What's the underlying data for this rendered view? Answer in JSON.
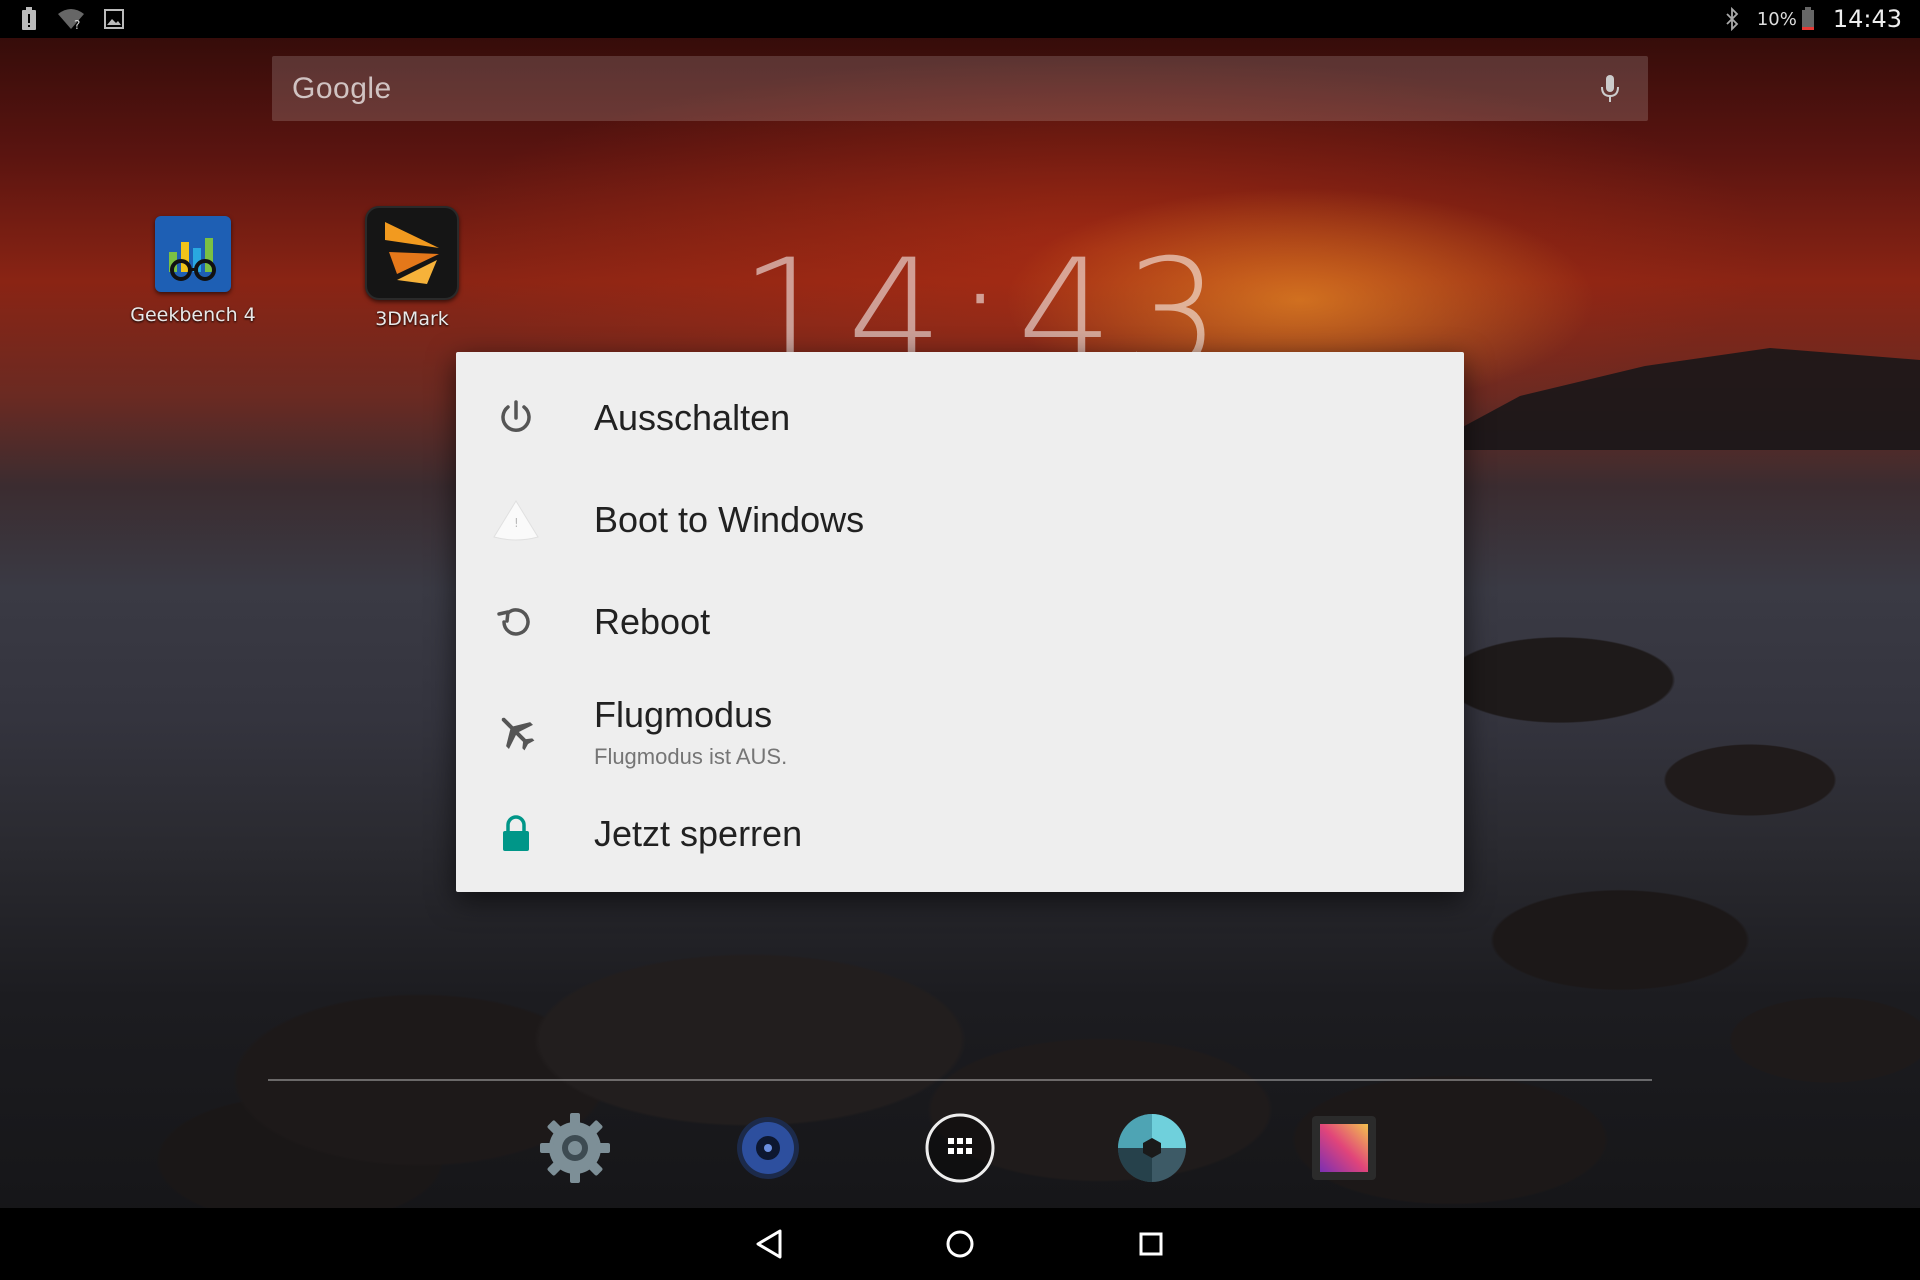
{
  "status_bar": {
    "battery_percent": "10%",
    "time": "14:43"
  },
  "search_bar": {
    "logo_text": "Google"
  },
  "desktop_apps": [
    {
      "label": "Geekbench 4",
      "icon": "geekbench-icon"
    },
    {
      "label": "3DMark",
      "icon": "3dmark-icon"
    }
  ],
  "clock_widget": {
    "time": "14:43"
  },
  "power_dialog": {
    "items": [
      {
        "label": "Ausschalten",
        "icon": "power-icon"
      },
      {
        "label": "Boot to Windows",
        "icon": "windows-boot-icon"
      },
      {
        "label": "Reboot",
        "icon": "reboot-icon"
      },
      {
        "label": "Flugmodus",
        "sublabel": "Flugmodus ist AUS.",
        "icon": "airplane-icon"
      },
      {
        "label": "Jetzt sperren",
        "icon": "lock-icon"
      }
    ],
    "accent_color": "#009688"
  },
  "dock": {
    "items": [
      "settings-icon",
      "music-icon",
      "app-drawer-icon",
      "camera-icon",
      "gallery-icon"
    ]
  },
  "nav_bar": {
    "buttons": [
      "back-icon",
      "home-icon",
      "recents-icon"
    ]
  }
}
